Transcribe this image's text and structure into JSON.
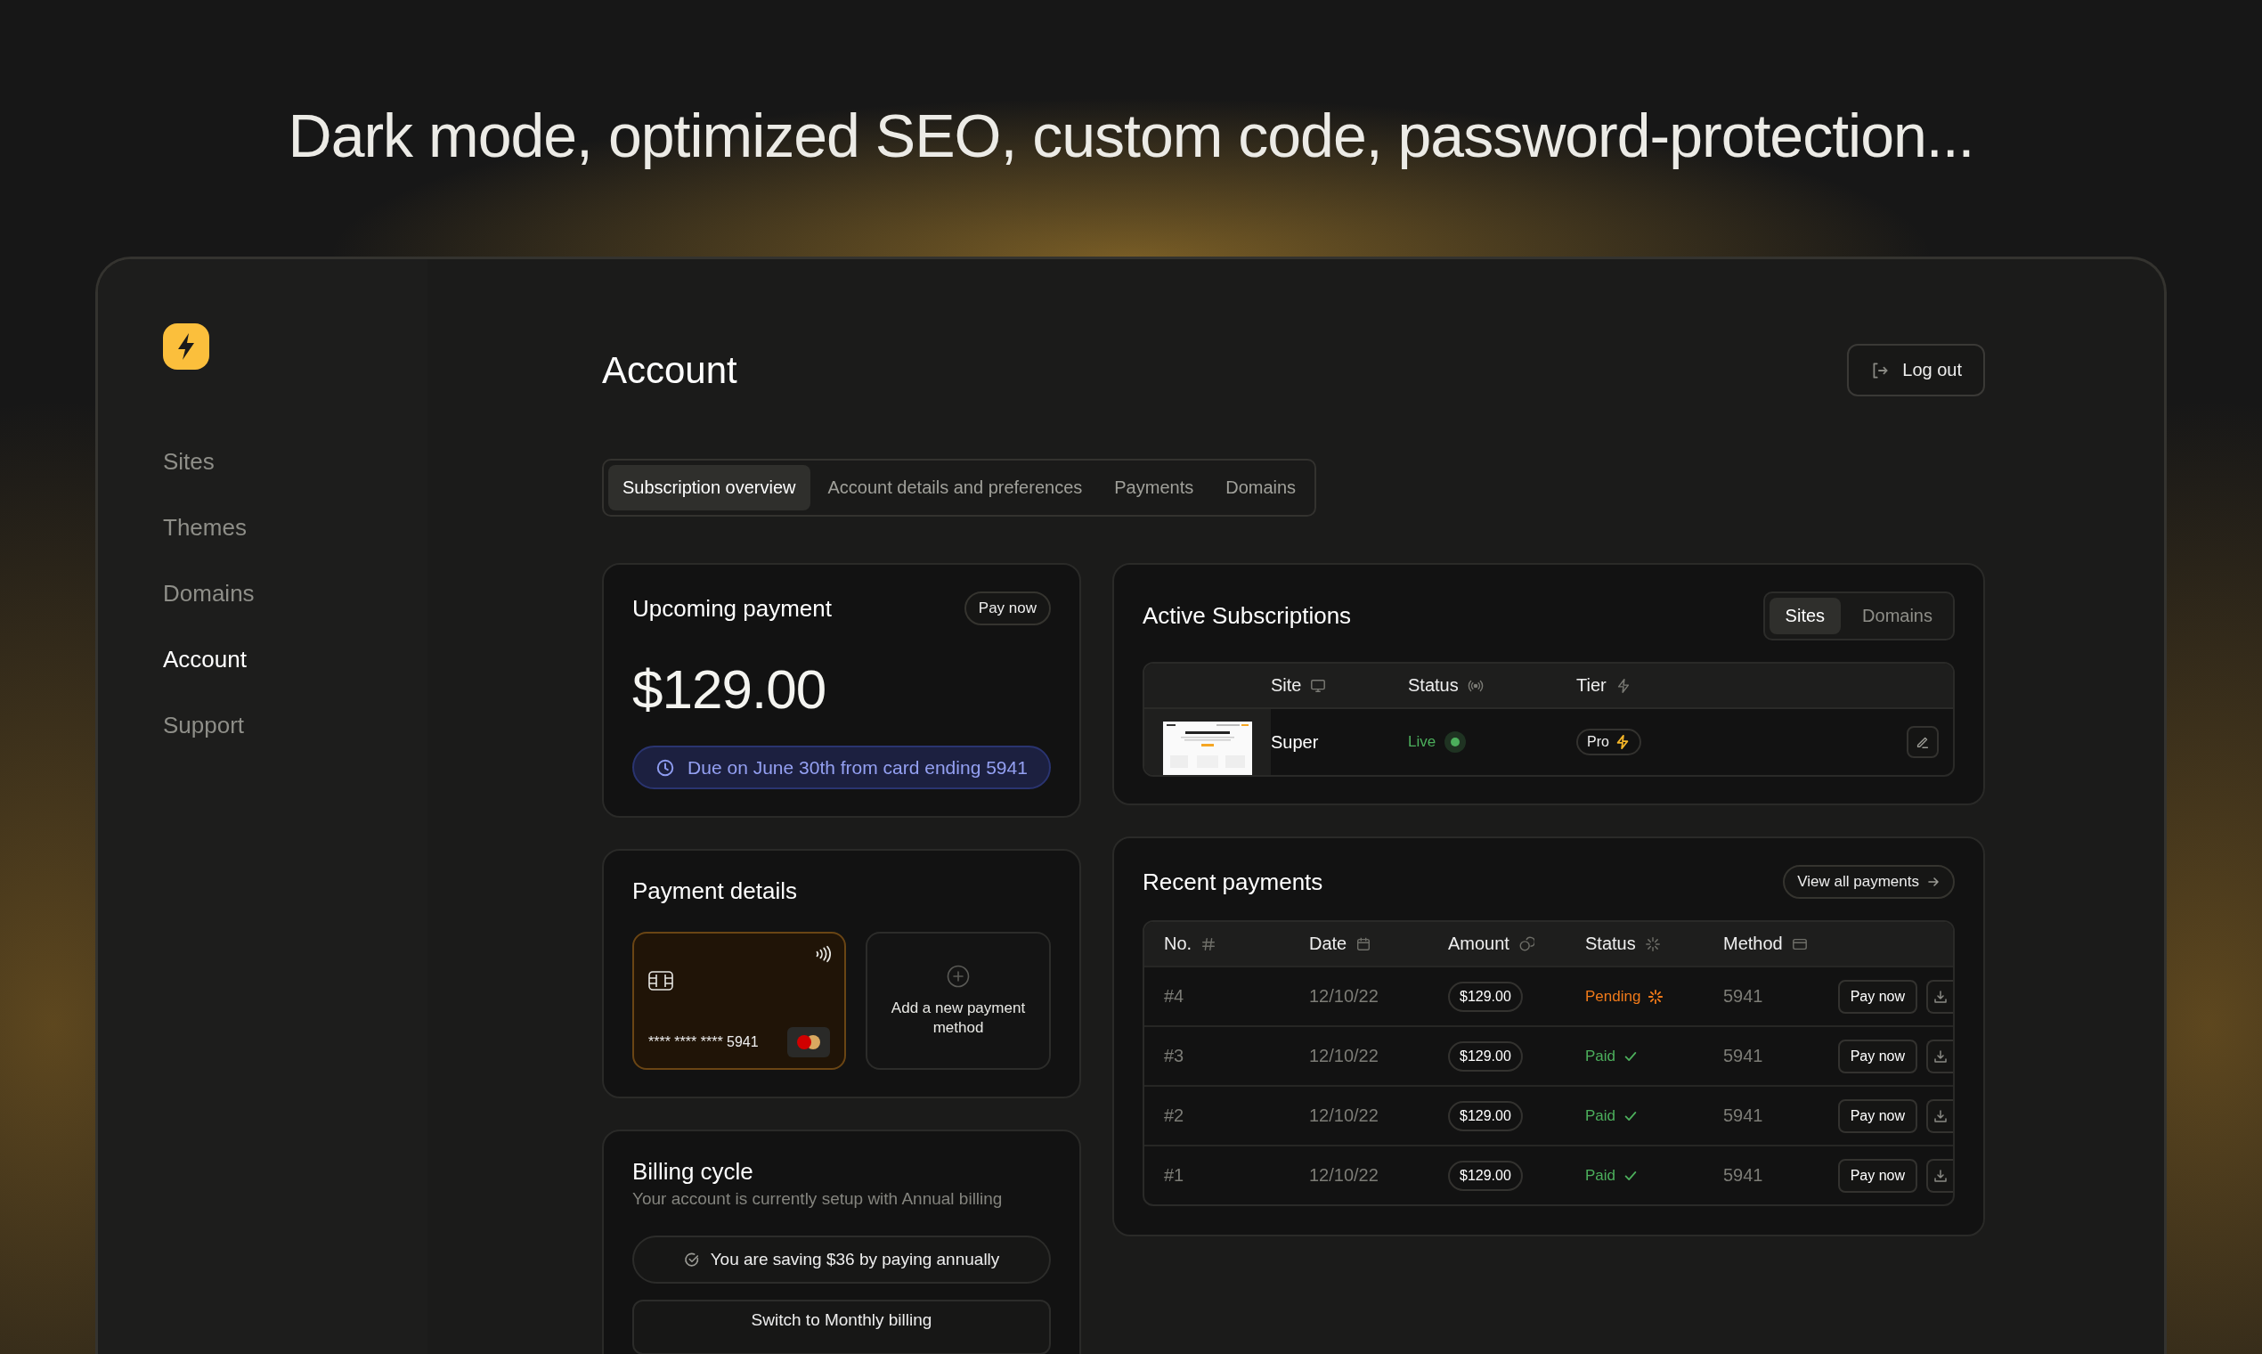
{
  "headline": "Dark mode, optimized SEO, custom code, password-protection...",
  "sidebar": {
    "items": [
      {
        "label": "Sites",
        "selected": false
      },
      {
        "label": "Themes",
        "selected": false
      },
      {
        "label": "Domains",
        "selected": false
      },
      {
        "label": "Account",
        "selected": true
      },
      {
        "label": "Support",
        "selected": false
      }
    ]
  },
  "page_title": "Account",
  "logout_button": "Log out",
  "tabs": [
    {
      "label": "Subscription overview",
      "selected": true
    },
    {
      "label": "Account details and preferences",
      "selected": false
    },
    {
      "label": "Payments",
      "selected": false
    },
    {
      "label": "Domains",
      "selected": false
    }
  ],
  "upcoming_payment": {
    "title": "Upcoming payment",
    "pay_button": "Pay now",
    "amount": "$129.00",
    "due_note": "Due on June 30th from card ending 5941"
  },
  "payment_details": {
    "title": "Payment details",
    "card_number": "**** **** **** 5941",
    "add_method": "Add a new payment method"
  },
  "billing_cycle": {
    "title": "Billing cycle",
    "subtitle": "Your account is currently setup with Annual billing",
    "saving_note": "You are saving $36 by paying annually",
    "switch_button": "Switch to Monthly billing"
  },
  "active_subscriptions": {
    "title": "Active Subscriptions",
    "toggle": [
      {
        "label": "Sites",
        "selected": true
      },
      {
        "label": "Domains",
        "selected": false
      }
    ],
    "columns": [
      "Site",
      "Status",
      "Tier"
    ],
    "rows": [
      {
        "site": "Super",
        "status": "Live",
        "kind": "live",
        "tier": "Pro"
      }
    ]
  },
  "recent_payments": {
    "title": "Recent payments",
    "view_all": "View all payments",
    "columns": [
      "No.",
      "Date",
      "Amount",
      "Status",
      "Method"
    ],
    "rows": [
      {
        "no": "#4",
        "date": "12/10/22",
        "amount": "$129.00",
        "status": "Pending",
        "kind": "pending",
        "method": "5941",
        "action": "Pay now"
      },
      {
        "no": "#3",
        "date": "12/10/22",
        "amount": "$129.00",
        "status": "Paid",
        "kind": "paid",
        "method": "5941",
        "action": "Pay now"
      },
      {
        "no": "#2",
        "date": "12/10/22",
        "amount": "$129.00",
        "status": "Paid",
        "kind": "paid",
        "method": "5941",
        "action": "Pay now"
      },
      {
        "no": "#1",
        "date": "12/10/22",
        "amount": "$129.00",
        "status": "Paid",
        "kind": "paid",
        "method": "5941",
        "action": "Pay now"
      }
    ]
  }
}
